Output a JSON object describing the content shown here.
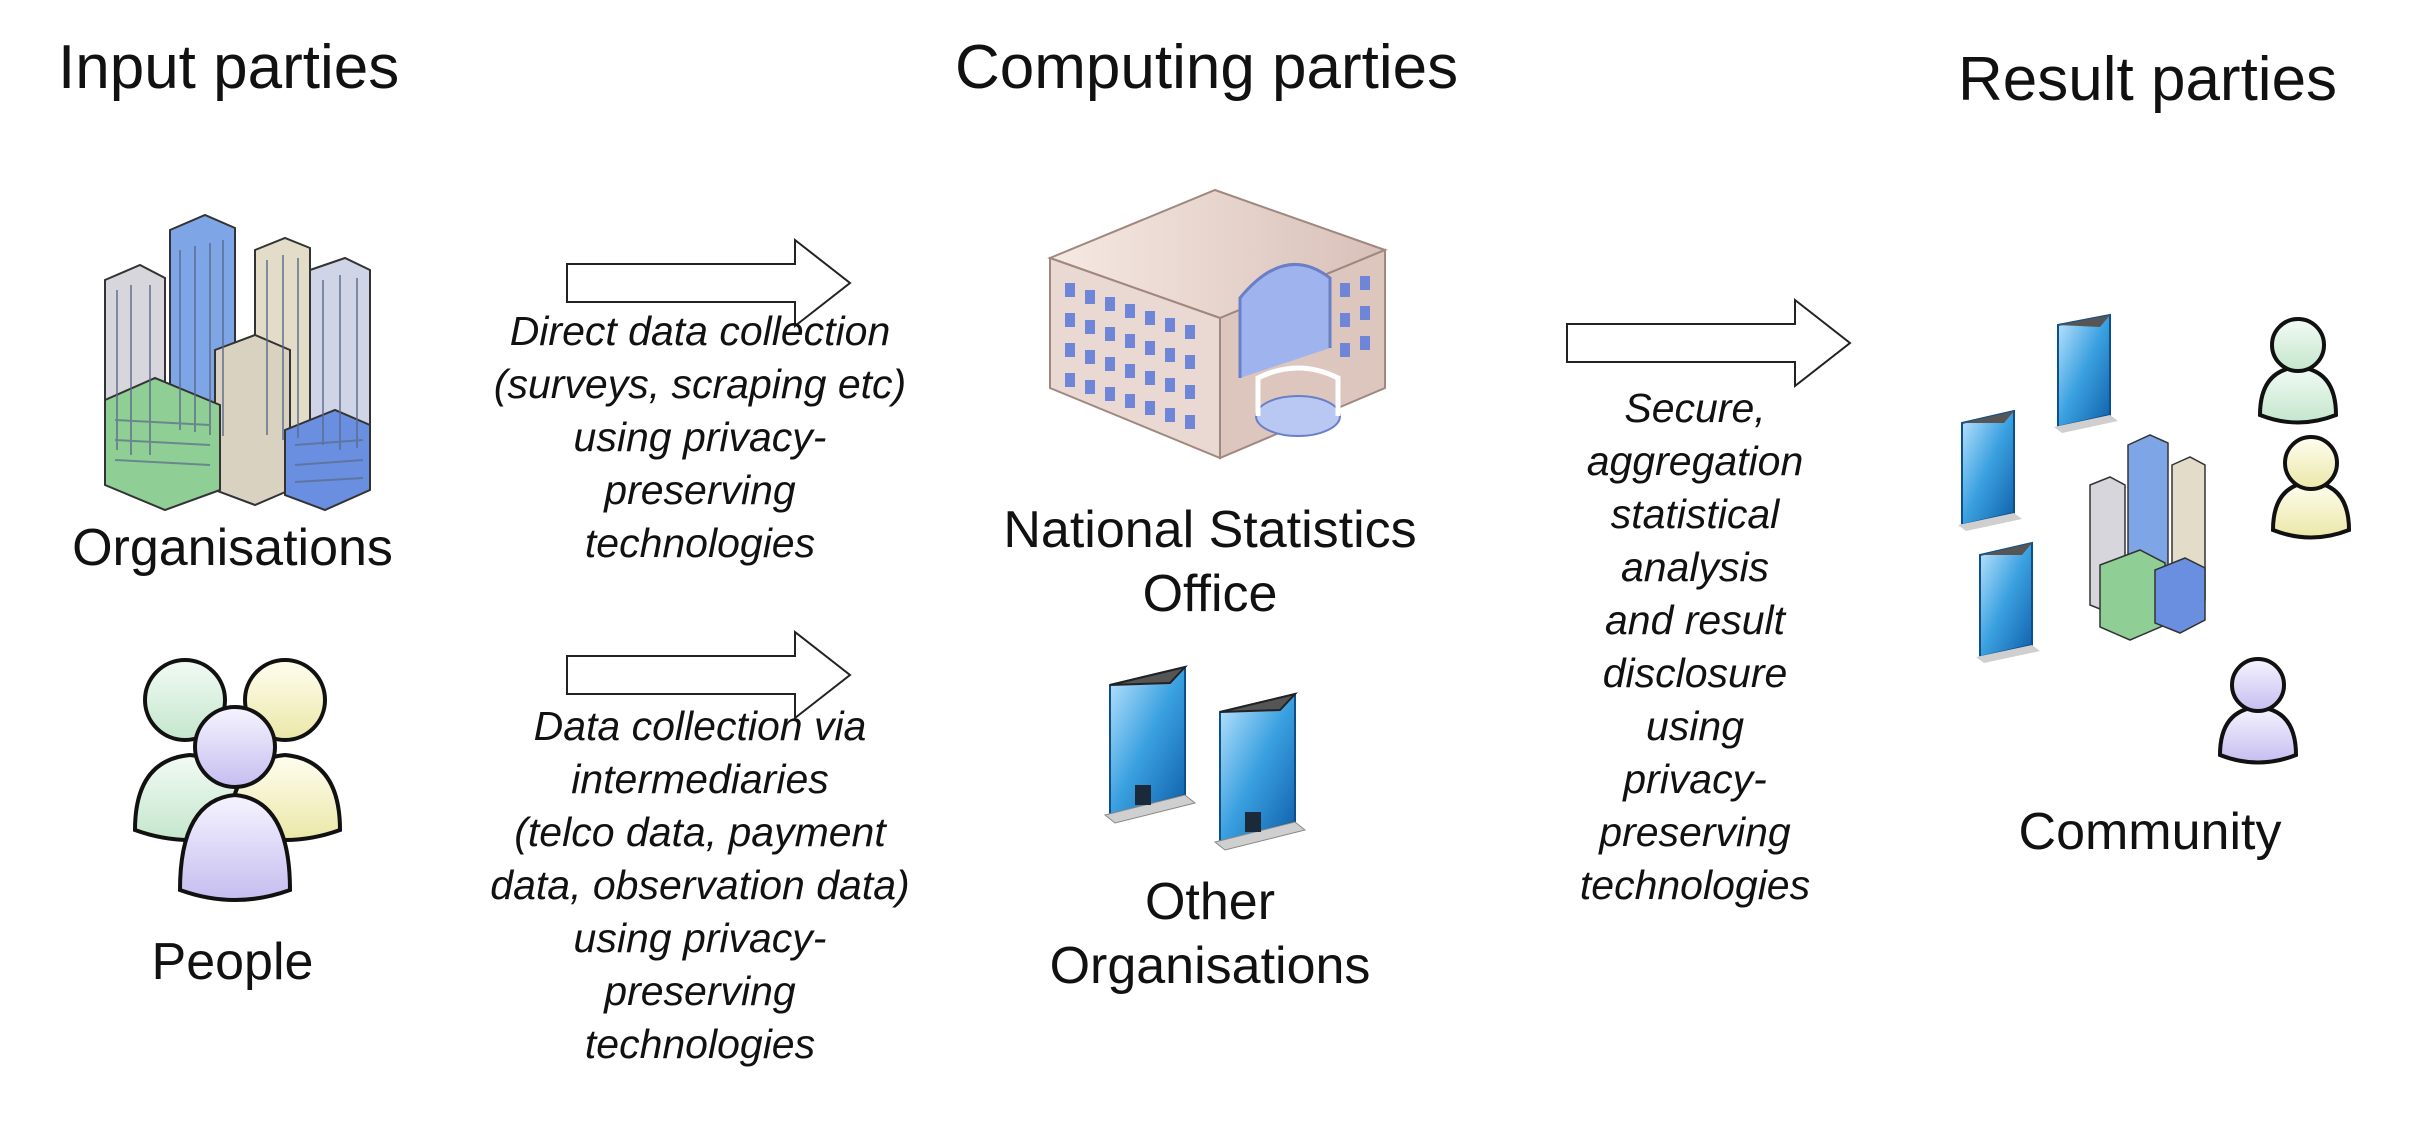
{
  "headings": {
    "input": "Input parties",
    "computing": "Computing parties",
    "result": "Result parties"
  },
  "input_parties": {
    "organisations_label": "Organisations",
    "people_label": "People"
  },
  "flows": {
    "direct_collection": [
      "Direct data collection",
      "(surveys, scraping etc)",
      "using privacy-",
      "preserving",
      "technologies"
    ],
    "intermediary_collection": [
      "Data collection via",
      "intermediaries",
      "(telco data, payment",
      "data, observation data)",
      "using privacy-",
      "preserving",
      "technologies"
    ],
    "secure_aggregation": [
      "Secure,",
      "aggregation",
      "statistical",
      "analysis",
      "and result",
      "disclosure",
      "using",
      "privacy-",
      "preserving",
      "technologies"
    ]
  },
  "computing_parties": {
    "nso_label": [
      "National Statistics",
      "Office"
    ],
    "other_label": [
      "Other",
      "Organisations"
    ]
  },
  "result_parties": {
    "community_label": "Community"
  },
  "icons": {
    "organisations": "city-buildings-icon",
    "people": "people-group-icon",
    "nso": "office-building-icon",
    "other": "glass-tower-icon",
    "community": "community-icon"
  },
  "colors": {
    "person_green": "#d9efe0",
    "person_yellow": "#f4f2c8",
    "person_purple": "#dcd6f2",
    "glass_blue": "#3aa0e0",
    "building_tan": "#e9d6cf"
  }
}
